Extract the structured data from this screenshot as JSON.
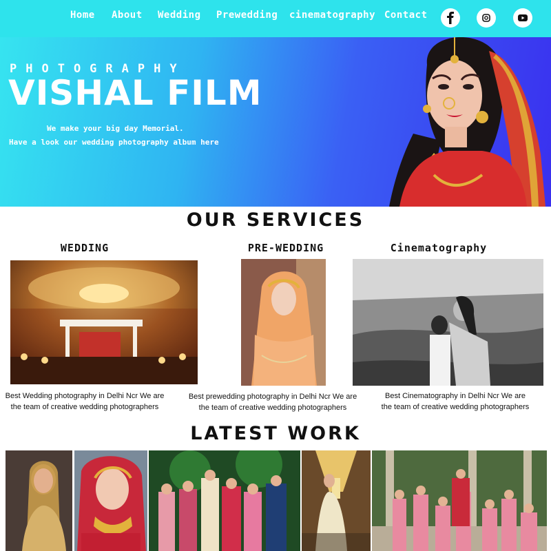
{
  "nav": {
    "items": [
      "Home",
      "About",
      "Wedding",
      "Prewedding",
      "cinematography",
      "Contact"
    ],
    "social": [
      "facebook-icon",
      "instagram-icon",
      "youtube-icon"
    ]
  },
  "hero": {
    "kicker": "PHOTOGRAPHY",
    "title": "VISHAL FILM",
    "tagline1": "We make your big day Memorial.",
    "tagline2": "Have a look our wedding photography album here"
  },
  "services": {
    "title": "OUR SERVICES",
    "items": [
      {
        "title": "WEDDING",
        "desc1": "Best Wedding photography in Delhi Ncr We are",
        "desc2": "the team of creative wedding photographers"
      },
      {
        "title": "PRE-WEDDING",
        "desc1": "Best prewedding photography in Delhi Ncr We are",
        "desc2": "the team of creative wedding photographers"
      },
      {
        "title": "Cinematography",
        "desc1": "Best Cinematography in Delhi Ncr We are",
        "desc2": "the team of creative wedding photographers"
      }
    ]
  },
  "latest": {
    "title": "LATEST WORK"
  },
  "colors": {
    "nav": "#2ee3ec",
    "hero_start": "#36e4f0",
    "hero_end": "#3a30ef"
  }
}
